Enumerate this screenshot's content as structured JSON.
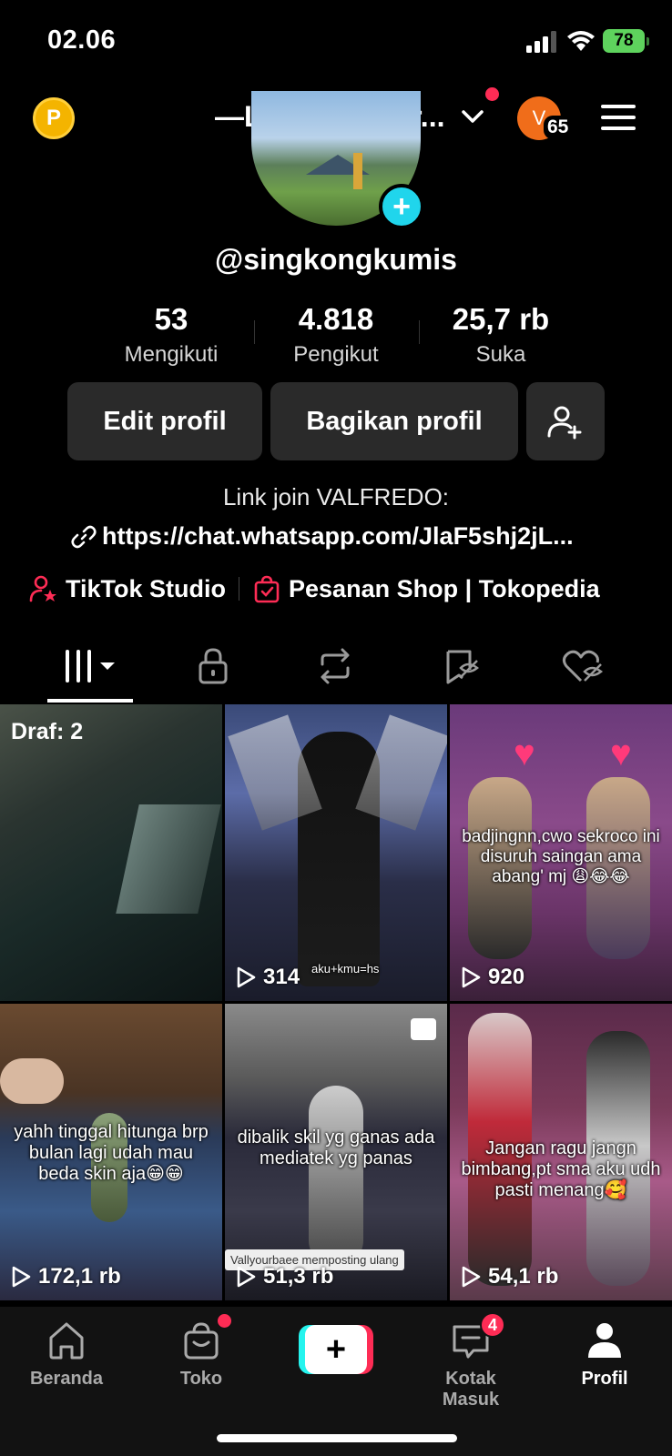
{
  "status_bar": {
    "time": "02.06",
    "battery": "78"
  },
  "top_nav": {
    "coin_letter": "P",
    "account_name": "—Langz withar...",
    "avatar_letter": "V",
    "avatar_count": "65"
  },
  "profile": {
    "username": "@singkongkumis",
    "stats": [
      {
        "value": "53",
        "label": "Mengikuti"
      },
      {
        "value": "4.818",
        "label": "Pengikut"
      },
      {
        "value": "25,7 rb",
        "label": "Suka"
      }
    ],
    "edit_label": "Edit profil",
    "share_label": "Bagikan profil",
    "bio": "Link join VALFREDO:",
    "link": "https://chat.whatsapp.com/JlaF5shj2jL...",
    "studio_label": "TikTok Studio",
    "shop_label": "Pesanan Shop | Tokopedia"
  },
  "tabs": [
    {
      "icon": "videos-grid-icon"
    },
    {
      "icon": "lock-icon"
    },
    {
      "icon": "repost-icon"
    },
    {
      "icon": "favorites-icon"
    },
    {
      "icon": "liked-icon"
    }
  ],
  "grid": {
    "draft_label": "Draf: 2",
    "videos": [
      {
        "caption": "",
        "views": ""
      },
      {
        "caption": "aku+kmu=hs",
        "views": "314"
      },
      {
        "caption": "badjingnn,cwo sekroco ini disuruh saingan ama abang' mj 😩😂😂",
        "views": "920"
      },
      {
        "caption": "yahh tinggal hitunga brp bulan lagi udah mau beda skin aja😁😁",
        "views": "172,1 rb"
      },
      {
        "caption": "dibalik skil yg ganas ada mediatek yg panas",
        "views": "51,3 rb",
        "repost": "Vallyourbaee memposting ulang"
      },
      {
        "caption": "Jangan ragu jangn bimbang,pt sma aku udh pasti menang🥰",
        "views": "54,1 rb"
      }
    ]
  },
  "bottom_nav": {
    "items": [
      "Beranda",
      "Toko",
      "Kotak Masuk",
      "Profil"
    ],
    "inbox_badge": "4"
  },
  "colors": {
    "accent": "#fe2c55",
    "cyan": "#25f4ee",
    "button_bg": "#2a2a2a"
  }
}
